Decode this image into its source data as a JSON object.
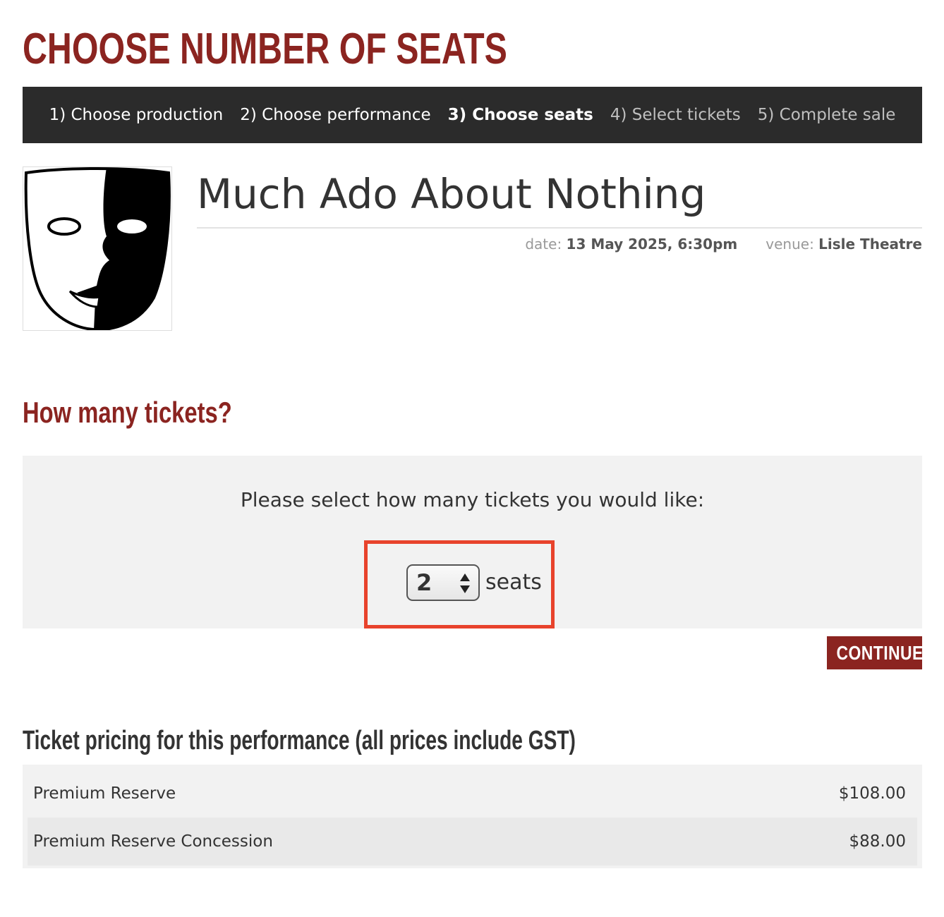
{
  "page": {
    "title": "CHOOSE NUMBER OF SEATS"
  },
  "steps": [
    {
      "label": "1) Choose production",
      "state": "done"
    },
    {
      "label": "2) Choose performance",
      "state": "done"
    },
    {
      "label": "3) Choose seats",
      "state": "current"
    },
    {
      "label": "4) Select tickets",
      "state": "future"
    },
    {
      "label": "5) Complete sale",
      "state": "future"
    }
  ],
  "production": {
    "title": "Much Ado About Nothing",
    "image_icon": "theatre-mask-icon",
    "date_label": "date:",
    "date_value": "13 May 2025, 6:30pm",
    "venue_label": "venue:",
    "venue_value": "Lisle Theatre"
  },
  "selection": {
    "heading": "How many tickets?",
    "prompt": "Please select how many tickets you would like:",
    "seat_count": "2",
    "seats_label": "seats",
    "stepper_icon": "up-down-arrows-icon"
  },
  "actions": {
    "continue_label": "CONTINUE"
  },
  "pricing": {
    "heading": "Ticket pricing for this performance (all prices include GST)",
    "rows": [
      {
        "name": "Premium Reserve",
        "price": "$108.00"
      },
      {
        "name": "Premium Reserve Concession",
        "price": "$88.00"
      }
    ]
  },
  "colors": {
    "brand": "#8b2420",
    "nav_bg": "#2b2b2b",
    "highlight": "#e8432c",
    "panel_bg": "#f2f2f2"
  }
}
